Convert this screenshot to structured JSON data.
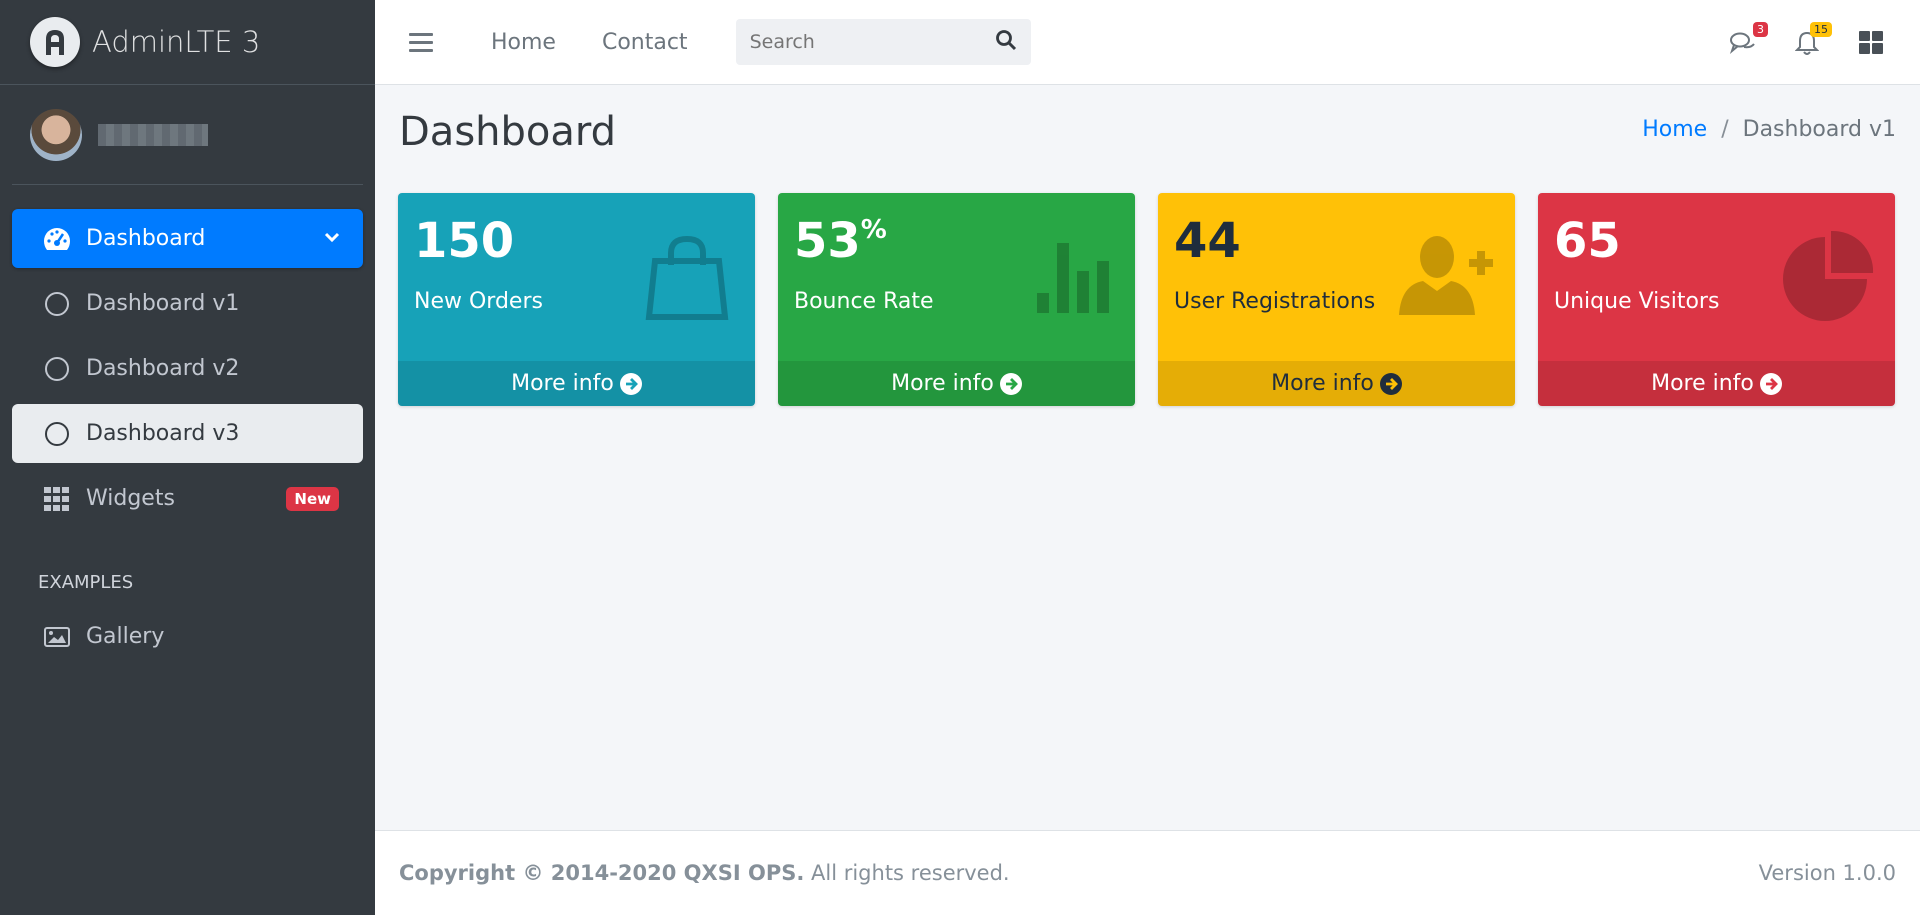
{
  "brand": {
    "name": "AdminLTE 3"
  },
  "sidebar": {
    "items": [
      {
        "label": "Dashboard",
        "icon": "tachometer-icon",
        "state": "active"
      },
      {
        "label": "Dashboard v1",
        "icon": "circle-outline-icon"
      },
      {
        "label": "Dashboard v2",
        "icon": "circle-outline-icon"
      },
      {
        "label": "Dashboard v3",
        "icon": "circle-outline-icon",
        "state": "highlighted"
      },
      {
        "label": "Widgets",
        "icon": "grid-icon",
        "badge": "New"
      }
    ],
    "header": "EXAMPLES",
    "examples": [
      {
        "label": "Gallery",
        "icon": "image-icon"
      }
    ]
  },
  "topbar": {
    "links": [
      "Home",
      "Contact"
    ],
    "search_placeholder": "Search",
    "messages_count": "3",
    "notifications_count": "15"
  },
  "page": {
    "title": "Dashboard",
    "breadcrumb": [
      "Home",
      "Dashboard v1"
    ]
  },
  "boxes": [
    {
      "value": "150",
      "suffix": "",
      "label": "New Orders",
      "footer": "More info",
      "color": "#17a2b8",
      "icon": "shopping-bag-icon"
    },
    {
      "value": "53",
      "suffix": "%",
      "label": "Bounce Rate",
      "footer": "More info",
      "color": "#28a745",
      "icon": "bar-chart-icon"
    },
    {
      "value": "44",
      "suffix": "",
      "label": "User Registrations",
      "footer": "More info",
      "color": "#ffc107",
      "icon": "user-plus-icon"
    },
    {
      "value": "65",
      "suffix": "",
      "label": "Unique Visitors",
      "footer": "More info",
      "color": "#dc3545",
      "icon": "pie-chart-icon"
    }
  ],
  "footer": {
    "copyright": "Copyright © 2014-2020 QXSI OPS.",
    "rights": " All rights reserved.",
    "version": "Version 1.0.0"
  },
  "colors": {
    "primary": "#007bff",
    "sidebar_bg": "#343a40",
    "badge_red": "#dc3545",
    "badge_yellow": "#ffc107"
  }
}
